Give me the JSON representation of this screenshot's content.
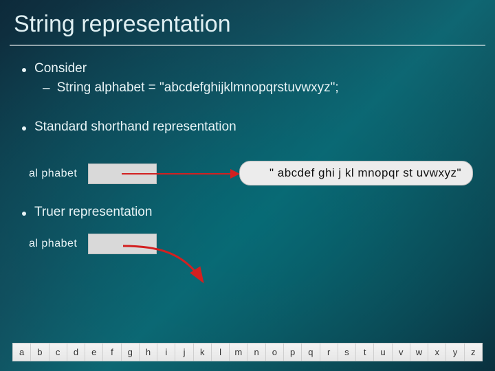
{
  "title": "String representation",
  "bullets": {
    "b1": "Consider",
    "b1_sub": "String alphabet = \"abcdefghijklmnopqrstuvwxyz\";",
    "b2": "Standard shorthand representation",
    "b3": "Truer representation"
  },
  "diagram": {
    "var_label": "al phabet",
    "value_string": "\" abcdef ghi j kl mnopqr st uvwxyz\""
  },
  "char_array": [
    "a",
    "b",
    "c",
    "d",
    "e",
    "f",
    "g",
    "h",
    "i",
    "j",
    "k",
    "l",
    "m",
    "n",
    "o",
    "p",
    "q",
    "r",
    "s",
    "t",
    "u",
    "v",
    "w",
    "x",
    "y",
    "z"
  ]
}
